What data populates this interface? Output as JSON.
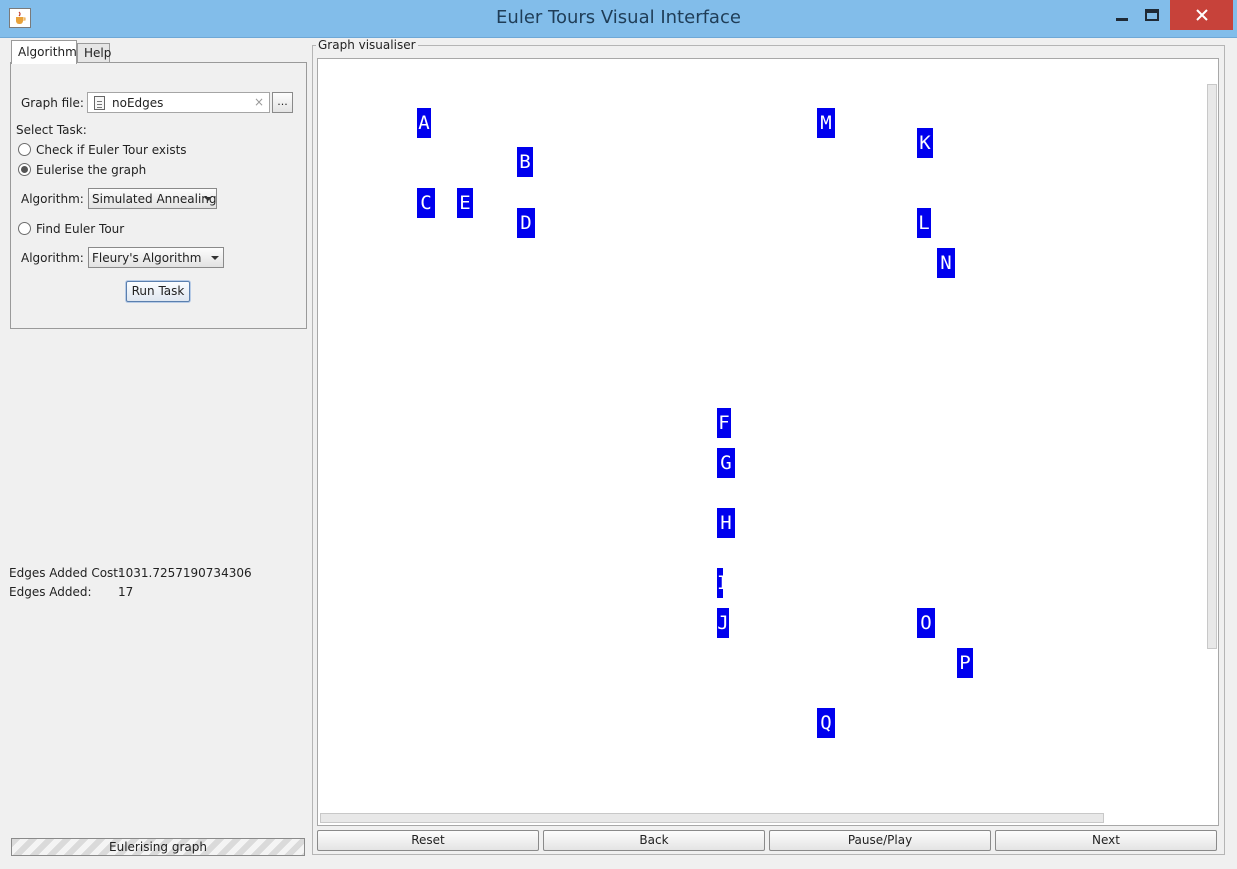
{
  "window": {
    "title": "Euler Tours Visual Interface",
    "icon": "java-cup-icon",
    "controls": [
      "minimize-icon",
      "maximize-icon",
      "close-icon"
    ]
  },
  "tabs": [
    {
      "label": "Algorithm",
      "selected": true
    },
    {
      "label": "Help",
      "selected": false
    }
  ],
  "algorithm_panel": {
    "graph_file_label": "Graph file:",
    "graph_file_value": "noEdges",
    "clear_symbol": "×",
    "browse_label": "...",
    "select_task_label": "Select Task:",
    "task_check": "Check if Euler Tour exists",
    "task_eulerise": "Eulerise the graph",
    "eulerise_algorithm_label": "Algorithm:",
    "eulerise_algorithm_value": "Simulated Annealing",
    "task_find": "Find Euler Tour",
    "find_algorithm_label": "Algorithm:",
    "find_algorithm_value": "Fleury's Algorithm",
    "selected_task": "Eulerise the graph",
    "run_button": "Run Task"
  },
  "results": {
    "cost_label": "Edges Added Cost:",
    "cost_value": "1031.7257190734306",
    "edges_label": "Edges Added:",
    "edges_value": "17"
  },
  "status": {
    "progress_text": "Eulerising graph"
  },
  "visualiser": {
    "title": "Graph visualiser",
    "node_color": "#0000ee",
    "nodes": [
      "A",
      "B",
      "C",
      "D",
      "E",
      "F",
      "G",
      "H",
      "I",
      "J",
      "K",
      "L",
      "M",
      "N",
      "O",
      "P",
      "Q"
    ]
  },
  "navigation": {
    "reset": "Reset",
    "back": "Back",
    "pause_play": "Pause/Play",
    "next": "Next"
  }
}
